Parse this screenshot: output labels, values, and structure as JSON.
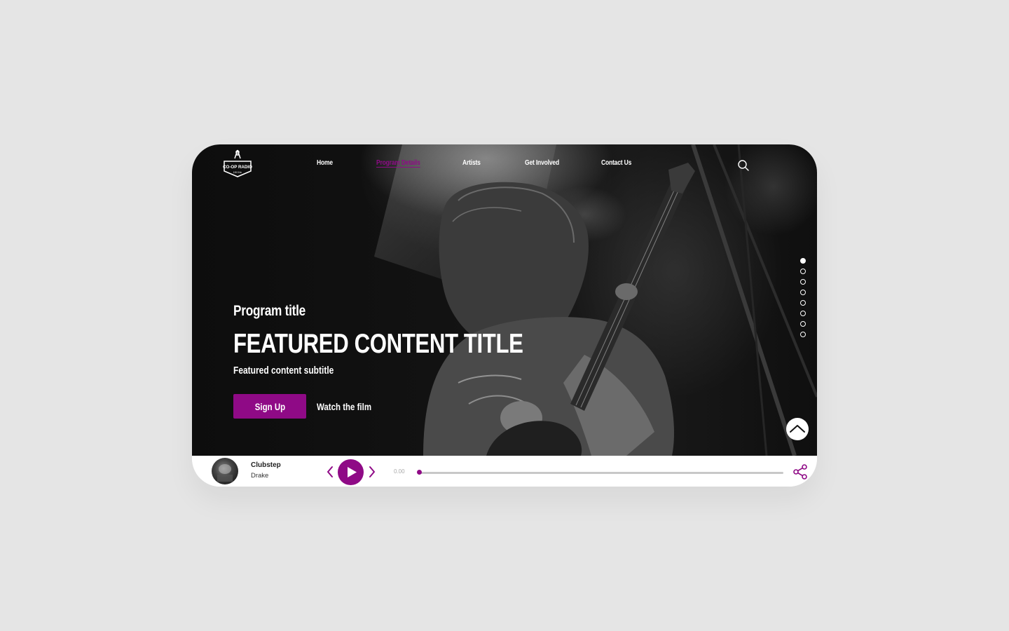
{
  "brand": {
    "logo_text": "CO-OP RADIO",
    "logo_subtext": "100.5 fm"
  },
  "nav": {
    "items": [
      {
        "label": "Home",
        "active": false
      },
      {
        "label": "Program Details",
        "active": true
      },
      {
        "label": "Artists",
        "active": false
      },
      {
        "label": "Get Involved",
        "active": false
      },
      {
        "label": "Contact Us",
        "active": false
      }
    ],
    "search_icon": "search-icon"
  },
  "hero": {
    "program_title": "Program title",
    "featured_title": "FEATURED CONTENT TITLE",
    "featured_subtitle": "Featured content subtitle",
    "primary_button": "Sign Up",
    "secondary_link": "Watch the film",
    "slides_total": 8,
    "active_slide": 1
  },
  "player": {
    "track_title": "Clubstep",
    "track_artist": "Drake",
    "time": "0.00",
    "progress": 0,
    "icons": [
      "chevron-left-icon",
      "play-icon",
      "chevron-right-icon",
      "share-icon"
    ]
  },
  "colors": {
    "accent": "#8f0a86",
    "page_background": "#e5e5e5",
    "hero_background": "#111111",
    "text_on_dark": "#ffffff"
  }
}
